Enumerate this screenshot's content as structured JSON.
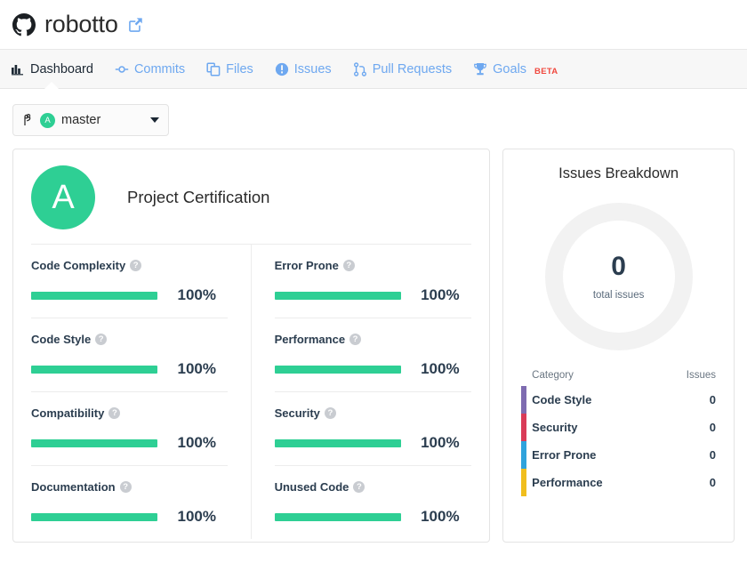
{
  "header": {
    "logo_icon": "github-icon",
    "repo_name": "robotto",
    "external_link_icon": "external-link-icon"
  },
  "nav": {
    "tabs": [
      {
        "label": "Dashboard",
        "icon": "bar-chart-icon",
        "active": true,
        "badge": ""
      },
      {
        "label": "Commits",
        "icon": "commit-icon",
        "active": false,
        "badge": ""
      },
      {
        "label": "Files",
        "icon": "files-icon",
        "active": false,
        "badge": ""
      },
      {
        "label": "Issues",
        "icon": "info-circle-icon",
        "active": false,
        "badge": ""
      },
      {
        "label": "Pull Requests",
        "icon": "pull-request-icon",
        "active": false,
        "badge": ""
      },
      {
        "label": "Goals",
        "icon": "trophy-icon",
        "active": false,
        "badge": "BETA"
      }
    ]
  },
  "branch_selector": {
    "icon": "branch-icon",
    "grade_badge": "A",
    "branch_name": "master",
    "caret_icon": "chevron-down-icon"
  },
  "certification": {
    "grade": "A",
    "title": "Project Certification",
    "metrics_left": [
      {
        "label": "Code Complexity",
        "percent": "100%",
        "value": 100,
        "help_icon": "help-circle-icon"
      },
      {
        "label": "Code Style",
        "percent": "100%",
        "value": 100,
        "help_icon": "help-circle-icon"
      },
      {
        "label": "Compatibility",
        "percent": "100%",
        "value": 100,
        "help_icon": "help-circle-icon"
      },
      {
        "label": "Documentation",
        "percent": "100%",
        "value": 100,
        "help_icon": "help-circle-icon"
      }
    ],
    "metrics_right": [
      {
        "label": "Error Prone",
        "percent": "100%",
        "value": 100,
        "help_icon": "help-circle-icon"
      },
      {
        "label": "Performance",
        "percent": "100%",
        "value": 100,
        "help_icon": "help-circle-icon"
      },
      {
        "label": "Security",
        "percent": "100%",
        "value": 100,
        "help_icon": "help-circle-icon"
      },
      {
        "label": "Unused Code",
        "percent": "100%",
        "value": 100,
        "help_icon": "help-circle-icon"
      }
    ]
  },
  "issues_breakdown": {
    "title": "Issues Breakdown",
    "total_count": "0",
    "total_label": "total issues",
    "col_category": "Category",
    "col_issues": "Issues",
    "rows": [
      {
        "name": "Code Style",
        "count": "0",
        "color": "#7e6bb0"
      },
      {
        "name": "Security",
        "count": "0",
        "color": "#d93b58"
      },
      {
        "name": "Error Prone",
        "count": "0",
        "color": "#2fa3dc"
      },
      {
        "name": "Performance",
        "count": "0",
        "color": "#f0be1e"
      }
    ]
  },
  "chart_data": {
    "type": "pie",
    "title": "Issues Breakdown",
    "categories": [
      "Code Style",
      "Security",
      "Error Prone",
      "Performance"
    ],
    "values": [
      0,
      0,
      0,
      0
    ],
    "colors": [
      "#7e6bb0",
      "#d93b58",
      "#2fa3dc",
      "#f0be1e"
    ],
    "total": 0,
    "center_label": "total issues",
    "legend_position": "bottom",
    "empty_ring_color": "#f2f2f2"
  },
  "theme": {
    "accent_green": "#2ecf94",
    "link_blue": "#6ea8f0",
    "beta_red": "#f0483e",
    "text_dark": "#2b3d4f"
  }
}
